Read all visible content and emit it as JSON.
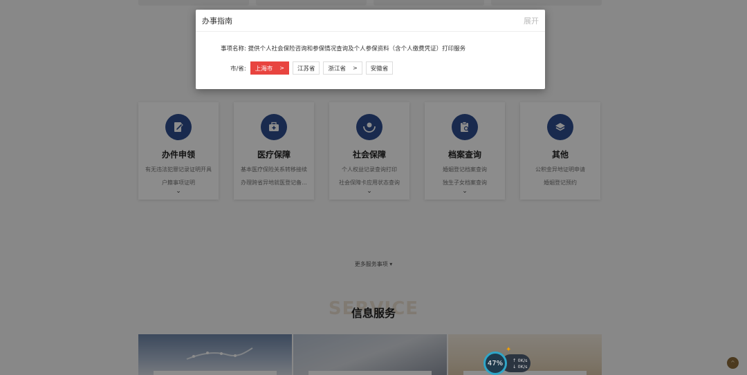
{
  "modal": {
    "title": "办事指南",
    "expand_label": "展开",
    "item_label": "事项名称:",
    "item_value": "提供个人社会保险咨询和参保情况查询及个人参保资料（含个人缴费凭证）打印服务",
    "region_label": "市/省:",
    "regions": [
      {
        "label": "上海市",
        "arrow": ">",
        "active": true
      },
      {
        "label": "江苏省",
        "arrow": "",
        "active": false
      },
      {
        "label": "浙江省",
        "arrow": ">",
        "active": false
      },
      {
        "label": "安徽省",
        "arrow": "",
        "active": false
      }
    ]
  },
  "service_cards": [
    {
      "title": "办件申领",
      "lines": [
        "有无违法犯罪记录证明开具",
        "户籍事项证明"
      ],
      "icon": "edit-document-icon",
      "chevron": "⌄"
    },
    {
      "title": "医疗保障",
      "lines": [
        "基本医疗保险关系转移接续",
        "办理跨省异地就医登记备..."
      ],
      "icon": "first-aid-kit-icon",
      "chevron": ""
    },
    {
      "title": "社会保障",
      "lines": [
        "个人权益记录查询打印",
        "社会保障卡应用状态查询"
      ],
      "icon": "protecting-hands-icon",
      "chevron": "⌄"
    },
    {
      "title": "档案查询",
      "lines": [
        "婚姻登记档案查询",
        "独生子女档案查询"
      ],
      "icon": "clipboard-search-icon",
      "chevron": "⌄"
    },
    {
      "title": "其他",
      "lines": [
        "公积金异地证明申请",
        "婚姻登记预约"
      ],
      "icon": "layers-icon",
      "chevron": ""
    }
  ],
  "more_services": "更多服务事项",
  "info_section": {
    "watermark": "SERVICE",
    "title": "信息服务"
  },
  "widget": {
    "percent": "47%",
    "up_speed": "0K/s",
    "down_speed": "0K/s"
  },
  "colors": {
    "accent_red": "#e8443f",
    "icon_blue": "#2f4d8e"
  }
}
